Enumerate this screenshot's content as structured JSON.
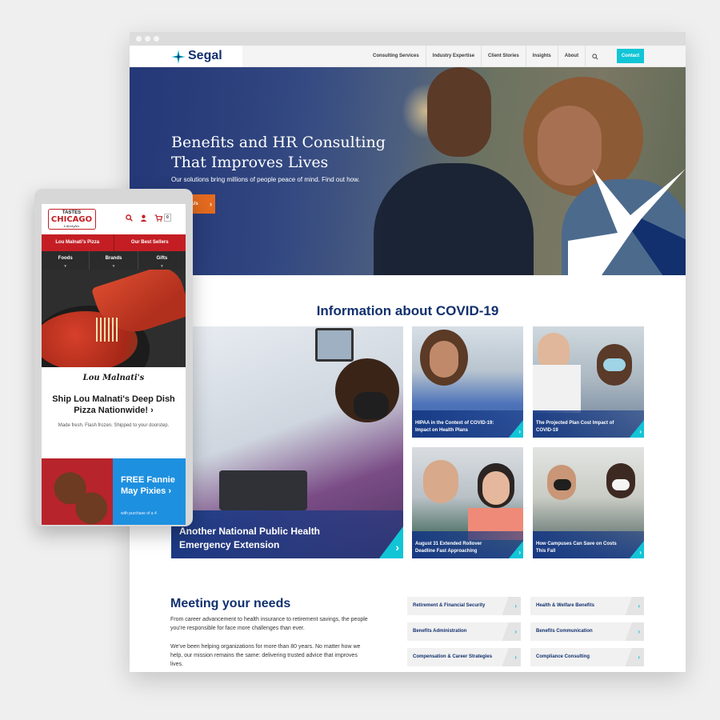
{
  "desktop": {
    "logo": {
      "name": "Segal"
    },
    "nav": {
      "items": [
        "Consulting Services",
        "Industry Expertise",
        "Client Stories",
        "Insights",
        "About"
      ],
      "contact_label": "Contact"
    },
    "hero": {
      "title": "Benefits and HR Consulting That Improves Lives",
      "subtitle": "Our solutions bring millions of people peace of mind. Find out how.",
      "button_label": "Us"
    },
    "covid": {
      "title": "Information about COVID-19",
      "cards": [
        {
          "caption": "Another National Public Health Emergency Extension"
        },
        {
          "caption": "HIPAA in the Context of COVID-19: Impact on Health Plans"
        },
        {
          "caption": "The Projected Plan Cost Impact of COVID-19"
        },
        {
          "caption": "August 31 Extended Rollover Deadline Fast Approaching"
        },
        {
          "caption": "How Campuses Can Save on Costs This Fall"
        }
      ]
    },
    "needs": {
      "title": "Meeting your needs",
      "p1": "From career advancement to health insurance to retirement savings, the people you're responsible for face more challenges than ever.",
      "p2": "We've been helping organizations for more than 80 years. No matter how we help, our mission remains the same: delivering trusted advice that improves lives.",
      "services": [
        "Retirement & Financial Security",
        "Health & Welfare Benefits",
        "Benefits Administration",
        "Benefits Communication",
        "Compensation & Career Strategies",
        "Compliance Consulting"
      ]
    },
    "colors": {
      "navy": "#12306e",
      "teal": "#11c5d6",
      "orange": "#e56a1f"
    }
  },
  "mobile": {
    "logo": {
      "line1": "TASTES",
      "line2": "CHICAGO",
      "line3": "Lifestyles"
    },
    "cart_count": "0",
    "red_nav": [
      "Lou Malnati's Pizza",
      "Our Best Sellers"
    ],
    "dark_nav": [
      "Foods",
      "Brands",
      "Gifts"
    ],
    "promo": {
      "brand": "Lou Malnati's",
      "title": "Ship Lou Malnati's Deep Dish Pizza Nationwide! ›",
      "subtitle": "Made fresh. Flash frozen. Shipped to your doorstep."
    },
    "fannie": {
      "title": "FREE Fannie May Pixies ›",
      "subtitle": "with purchase of a 4"
    },
    "colors": {
      "red": "#c41e24",
      "blue": "#1e90e0"
    }
  }
}
